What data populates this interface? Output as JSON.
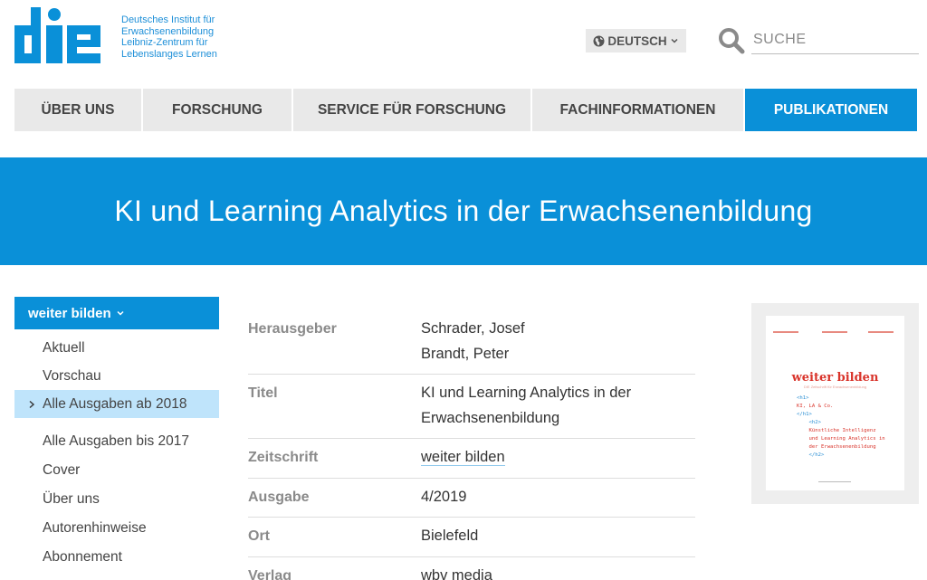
{
  "header": {
    "logo_lines": [
      "Deutsches Institut für",
      "Erwachsenenbildung",
      "Leibniz-Zentrum für",
      "Lebenslanges Lernen"
    ],
    "language_label": "DEUTSCH",
    "search_placeholder": "SUCHE"
  },
  "nav": {
    "items": [
      {
        "label": "ÜBER UNS"
      },
      {
        "label": "FORSCHUNG"
      },
      {
        "label": "SERVICE FÜR FORSCHUNG"
      },
      {
        "label": "FACHINFORMATIONEN"
      },
      {
        "label": "PUBLIKATIONEN"
      }
    ],
    "active": "PUBLIKATIONEN"
  },
  "banner": {
    "title": "KI und Learning Analytics in der Erwachsenenbildung"
  },
  "sidebar": {
    "heading": "weiter bilden",
    "items": [
      {
        "label": "Aktuell"
      },
      {
        "label": "Vorschau"
      },
      {
        "label": "Alle Ausgaben ab 2018"
      },
      {
        "label": "Alle Ausgaben bis 2017"
      },
      {
        "label": "Cover"
      },
      {
        "label": "Über uns"
      },
      {
        "label": "Autorenhinweise"
      },
      {
        "label": "Abonnement"
      }
    ],
    "active": "Alle Ausgaben ab 2018"
  },
  "details": {
    "herausgeber_label": "Herausgeber",
    "herausgeber_1": "Schrader, Josef",
    "herausgeber_2": "Brandt, Peter",
    "titel_label": "Titel",
    "titel_1": "KI und Learning Analytics in der",
    "titel_2": "Erwachsenenbildung",
    "zeitschrift_label": "Zeitschrift",
    "zeitschrift": "weiter bilden",
    "ausgabe_label": "Ausgabe",
    "ausgabe": "4/2019",
    "ort_label": "Ort",
    "ort": "Bielefeld",
    "verlag_label": "Verlag",
    "verlag": "wbv media"
  },
  "cover": {
    "title": "weiter bilden",
    "subtitle": "DIE Zeitschrift für Erwachsenenbildung",
    "code_1": "<h1>",
    "code_2": "KI, LA & Co.",
    "code_3": "</h1>",
    "code_4": "<h2>",
    "code_5": "Künstliche Intelligenz",
    "code_6": "und Learning Analytics in",
    "code_7": "der Erwachsenenbildung",
    "code_8": "</h2>"
  },
  "colors": {
    "brand_blue": "#0a90d8",
    "active_side": "#bfe4fb",
    "nav_gray": "#e9e9e9",
    "cover_red": "#d9342b"
  }
}
